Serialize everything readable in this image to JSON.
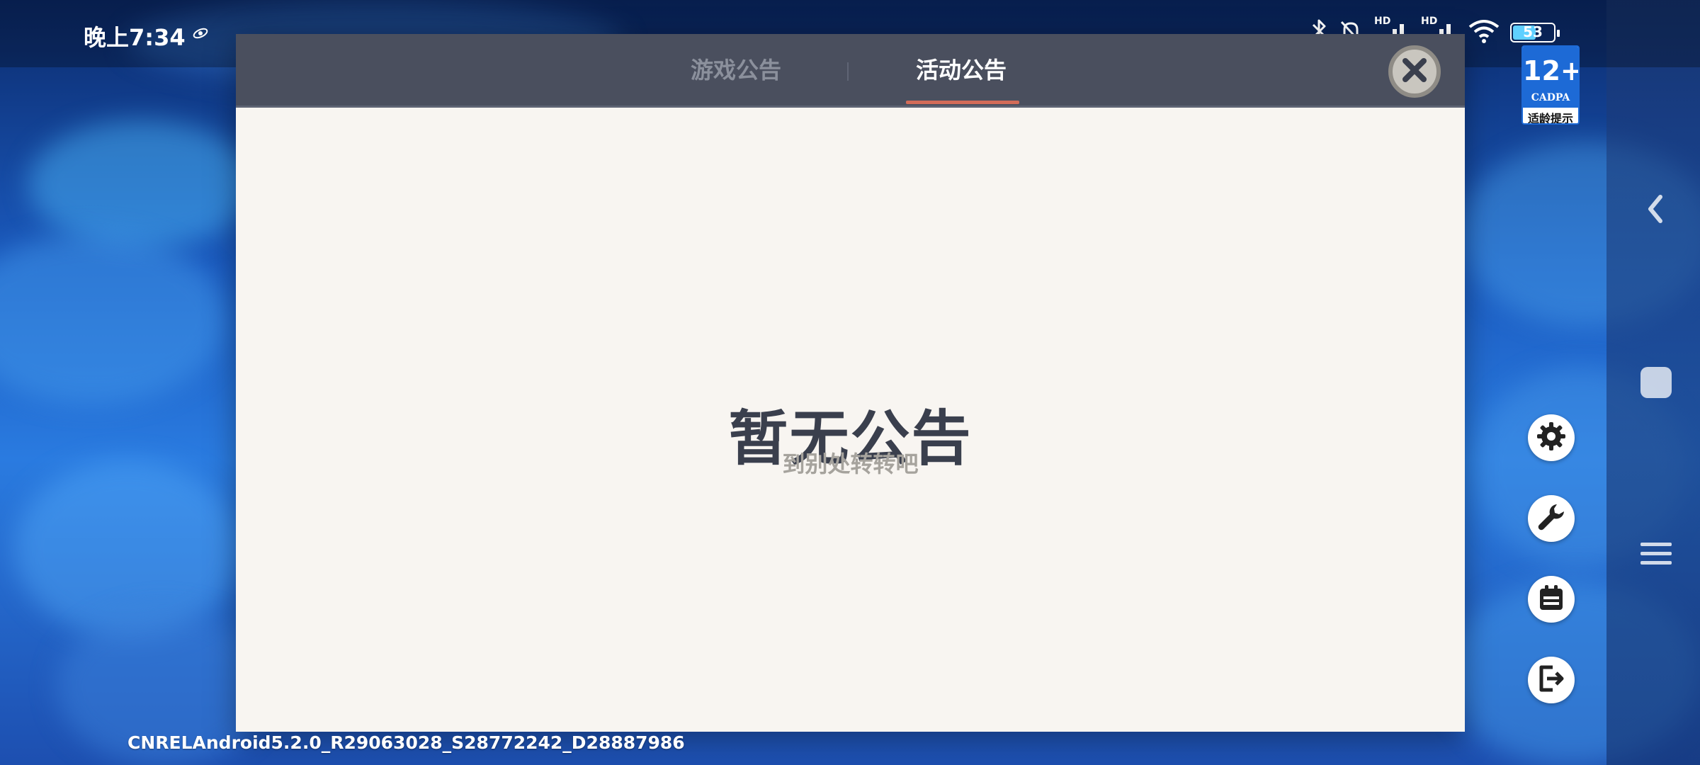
{
  "status_bar": {
    "time": "晚上7:34",
    "battery_level": "53",
    "icons": [
      "bluetooth-icon",
      "silent-bell-icon",
      "hd-signal-icon",
      "hd-signal-icon",
      "wifi-icon",
      "battery-icon"
    ],
    "hd_labels": [
      "HD",
      "HD"
    ]
  },
  "dialog": {
    "tabs": [
      {
        "label": "游戏公告",
        "active": false
      },
      {
        "label": "活动公告",
        "active": true
      }
    ],
    "empty_title": "暂无公告",
    "empty_subtitle": "到别处转转吧",
    "accent_color": "#d36c58"
  },
  "age_rating": {
    "number": "12+",
    "org": "CADPA",
    "label": "适龄提示"
  },
  "side_buttons": [
    "settings-gear-icon",
    "wrench-icon",
    "notice-board-icon",
    "logout-icon"
  ],
  "nav_buttons": [
    "back-arrow-icon",
    "home-square-icon",
    "menu-lines-icon"
  ],
  "build_string": "CNRELAndroid5.2.0_R29063028_S28772242_D28887986"
}
